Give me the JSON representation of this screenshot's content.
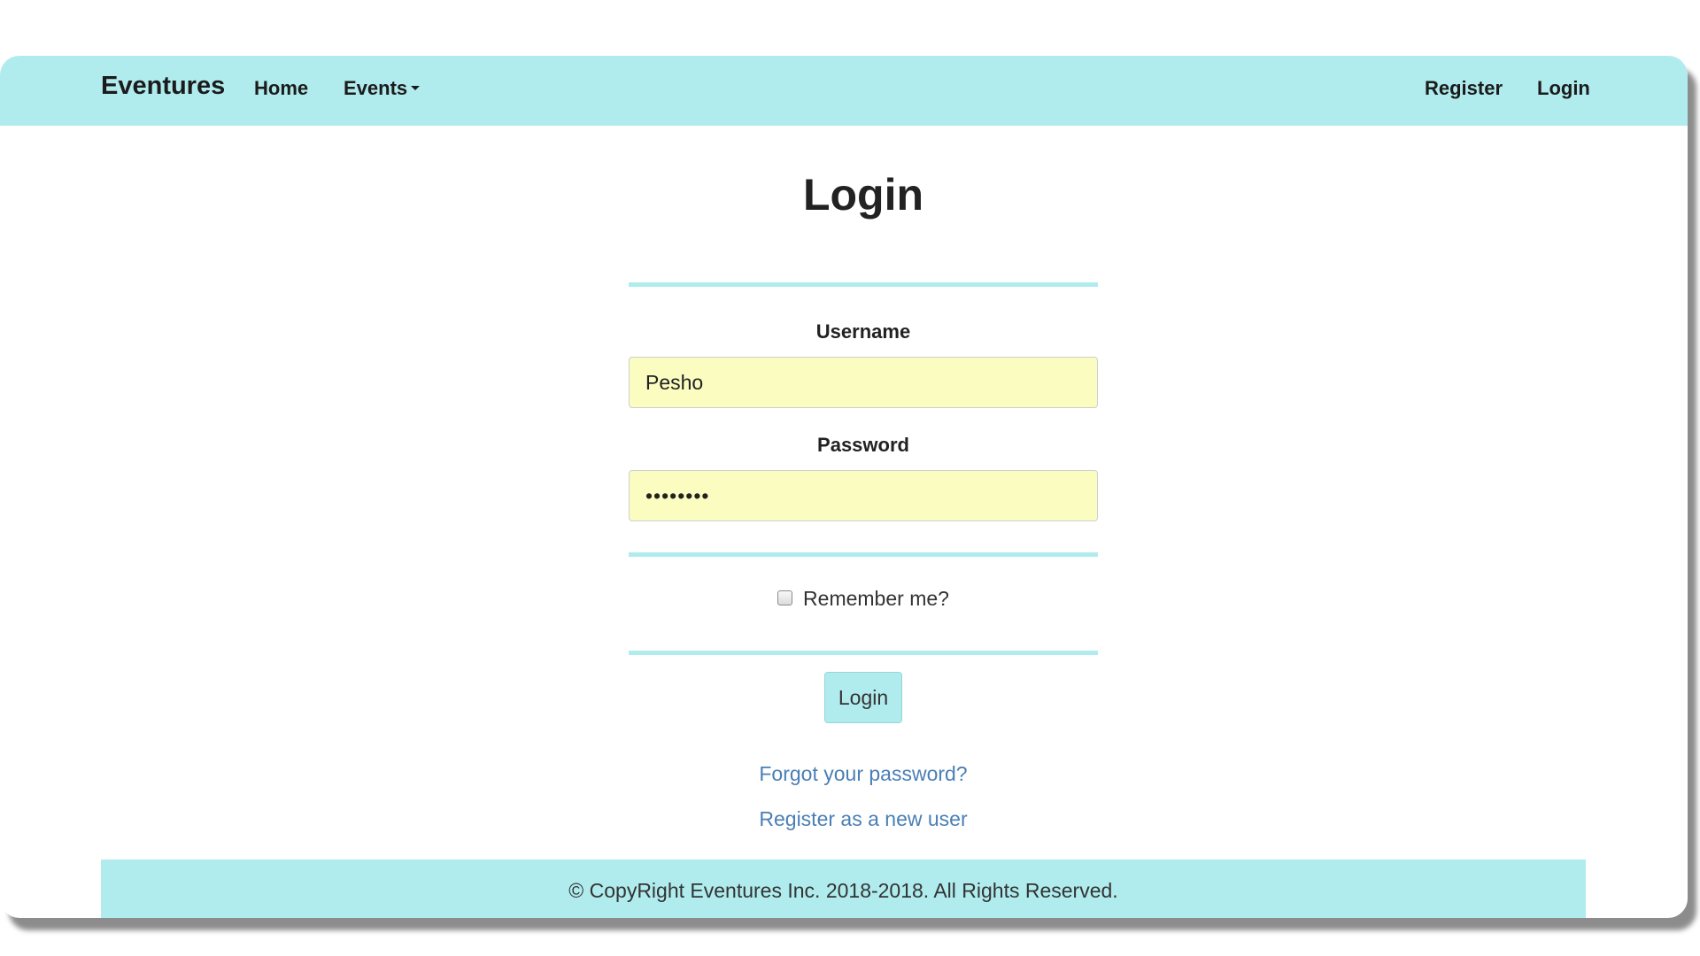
{
  "navbar": {
    "brand": "Eventures",
    "home": "Home",
    "events": "Events",
    "register": "Register",
    "login": "Login"
  },
  "form": {
    "title": "Login",
    "username_label": "Username",
    "username_value": "Pesho",
    "password_label": "Password",
    "password_value": "••••••••",
    "remember_label": "Remember me?",
    "submit_label": "Login"
  },
  "links": {
    "forgot": "Forgot your password?",
    "register_new": "Register as a new user"
  },
  "footer": {
    "text": "© CopyRight Eventures Inc. 2018-2018. All Rights Reserved."
  },
  "colors": {
    "accent": "#b0ecee",
    "autofill": "#fafcc0",
    "link": "#4a7fb5"
  }
}
